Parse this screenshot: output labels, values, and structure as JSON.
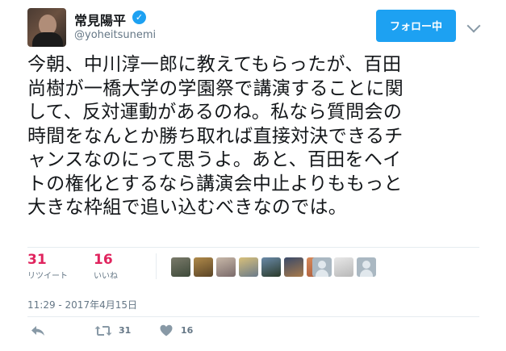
{
  "author": {
    "name": "常見陽平",
    "handle": "@yoheitsunemi",
    "verified_glyph": "✓"
  },
  "follow_button": {
    "label": "フォロー中"
  },
  "tweet": {
    "text": "今朝、中川淳一郎に教えてもらったが、百田\n尚樹が一橋大学の学園祭で講演することに関\nして、反対運動があるのね。私なら質問会の\n時間をなんとか勝ち取れば直接対決できるチ\nャンスなのにって思うよ。あと、百田をヘイ\nトの権化とするなら講演会中止よりももっと\n大きな枠組で追い込むべきなのでは。"
  },
  "stats": {
    "retweets": {
      "count": "31",
      "label": "リツイート"
    },
    "likes": {
      "count": "16",
      "label": "いいね"
    }
  },
  "timestamp": "11:29 - 2017年4月15日",
  "actions": {
    "retweet_count": "31",
    "like_count": "16"
  },
  "icons": {
    "verified": "verified-badge-icon",
    "dropdown": "chevron-down-icon",
    "reply": "reply-icon",
    "retweet": "retweet-icon",
    "like": "heart-icon"
  },
  "colors": {
    "accent": "#1da1f2",
    "stat_count": "#e0245e",
    "muted": "#657786"
  }
}
